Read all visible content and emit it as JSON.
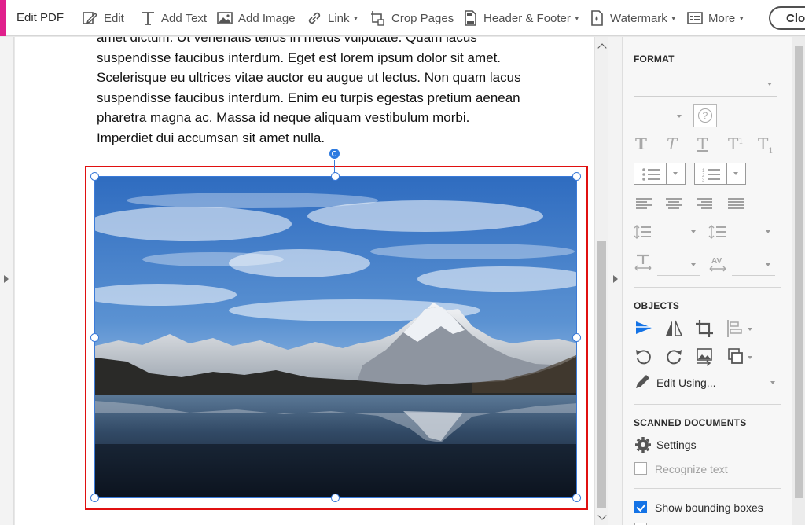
{
  "toolbar": {
    "app_title": "Edit PDF",
    "buttons": [
      {
        "label": "Edit",
        "icon": "edit-icon"
      },
      {
        "label": "Add Text",
        "icon": "text-icon"
      },
      {
        "label": "Add Image",
        "icon": "image-icon"
      },
      {
        "label": "Link",
        "icon": "link-icon"
      },
      {
        "label": "Crop Pages",
        "icon": "crop-pages-icon"
      },
      {
        "label": "Header & Footer",
        "icon": "header-footer-icon"
      },
      {
        "label": "Watermark",
        "icon": "watermark-icon"
      },
      {
        "label": "More",
        "icon": "more-icon"
      }
    ],
    "close_label": "Close"
  },
  "document": {
    "lines": [
      "amet dictum. Ut venenatis tellus in metus vulputate. Quam lacus",
      "suspendisse faucibus interdum. Eget est lorem ipsum dolor sit amet.",
      "Scelerisque eu ultrices vitae auctor eu augue ut lectus. Non quam lacus",
      "suspendisse faucibus interdum. Enim eu turpis egestas pretium aenean",
      "pharetra magna ac. Massa id neque aliquam vestibulum morbi.",
      "Imperdiet dui accumsan sit amet nulla."
    ],
    "image_description": "mountain-lake-photo"
  },
  "panel": {
    "format_title": "FORMAT",
    "objects_title": "OBJECTS",
    "edit_using_label": "Edit Using...",
    "scanned_title": "SCANNED DOCUMENTS",
    "settings_label": "Settings",
    "recognize_text_label": "Recognize text",
    "show_bounding_boxes_label": "Show bounding boxes",
    "show_bounding_boxes_checked": true
  },
  "colors": {
    "accent": "#e0208c",
    "selection": "#e01010",
    "handle": "#3a7ad8",
    "active_blue": "#1473e6"
  }
}
